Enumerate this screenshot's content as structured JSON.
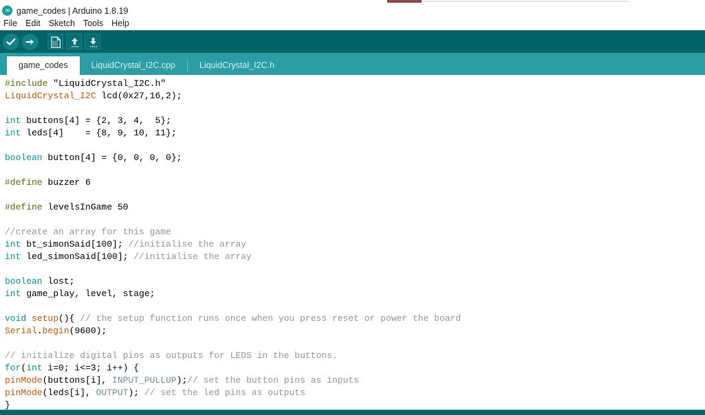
{
  "window": {
    "title": "game_codes | Arduino 1.8.19",
    "logo_icon": "arduino-infinity-icon",
    "logo_glyph": "∞"
  },
  "menu": {
    "items": [
      {
        "label": "File",
        "name": "menu-file"
      },
      {
        "label": "Edit",
        "name": "menu-edit"
      },
      {
        "label": "Sketch",
        "name": "menu-sketch"
      },
      {
        "label": "Tools",
        "name": "menu-tools"
      },
      {
        "label": "Help",
        "name": "menu-help"
      }
    ]
  },
  "toolbar": {
    "buttons": [
      {
        "label": "Verify",
        "icon": "check-icon",
        "shape": "round"
      },
      {
        "label": "Upload",
        "icon": "arrow-right-icon",
        "shape": "round"
      },
      {
        "label": "New",
        "icon": "new-document-icon",
        "shape": "square"
      },
      {
        "label": "Open",
        "icon": "arrow-up-icon",
        "shape": "square"
      },
      {
        "label": "Save",
        "icon": "arrow-down-icon",
        "shape": "square"
      }
    ]
  },
  "tabs": {
    "items": [
      {
        "label": "game_codes",
        "active": true
      },
      {
        "label": "LiquidCrystal_I2C.cpp",
        "active": false
      },
      {
        "label": "LiquidCrystal_I2C.h",
        "active": false
      }
    ]
  },
  "colors": {
    "toolbar_bg": "#006468",
    "tabbar_bg": "#2a9da5",
    "active_tab_bg": "#ffffff",
    "editor_bg": "#ffffff",
    "keyword": "#00979c",
    "preprocessor": "#5e6d03",
    "function": "#d35400",
    "constant": "#718c9e",
    "comment": "#959595"
  },
  "editor": {
    "lines": [
      [
        {
          "t": "#include ",
          "c": "pre"
        },
        {
          "t": "\"LiquidCrystal_I2C.h\"",
          "c": "plain"
        }
      ],
      [
        {
          "t": "LiquidCrystal_I2C",
          "c": "type"
        },
        {
          "t": " lcd(0x27,16,2);",
          "c": "plain"
        }
      ],
      [
        {
          "t": "",
          "c": "plain"
        }
      ],
      [
        {
          "t": "int",
          "c": "kw"
        },
        {
          "t": " buttons[4] = {2, 3, 4,  5};",
          "c": "plain"
        }
      ],
      [
        {
          "t": "int",
          "c": "kw"
        },
        {
          "t": " leds[4]    = {8, 9, 10, 11};",
          "c": "plain"
        }
      ],
      [
        {
          "t": "",
          "c": "plain"
        }
      ],
      [
        {
          "t": "boolean",
          "c": "kw"
        },
        {
          "t": " button[4] = {0, 0, 0, 0};",
          "c": "plain"
        }
      ],
      [
        {
          "t": "",
          "c": "plain"
        }
      ],
      [
        {
          "t": "#define",
          "c": "pre"
        },
        {
          "t": " buzzer 6",
          "c": "plain"
        }
      ],
      [
        {
          "t": "",
          "c": "plain"
        }
      ],
      [
        {
          "t": "#define",
          "c": "pre"
        },
        {
          "t": " levelsInGame 50",
          "c": "plain"
        }
      ],
      [
        {
          "t": "",
          "c": "plain"
        }
      ],
      [
        {
          "t": "//create an array for this game",
          "c": "com"
        }
      ],
      [
        {
          "t": "int",
          "c": "kw"
        },
        {
          "t": " bt_simonSaid[100]; ",
          "c": "plain"
        },
        {
          "t": "//initialise the array",
          "c": "com"
        }
      ],
      [
        {
          "t": "int",
          "c": "kw"
        },
        {
          "t": " led_simonSaid[100]; ",
          "c": "plain"
        },
        {
          "t": "//initialise the array",
          "c": "com"
        }
      ],
      [
        {
          "t": "",
          "c": "plain"
        }
      ],
      [
        {
          "t": "boolean",
          "c": "kw"
        },
        {
          "t": " lost;",
          "c": "plain"
        }
      ],
      [
        {
          "t": "int",
          "c": "kw"
        },
        {
          "t": " game_play, level, stage;",
          "c": "plain"
        }
      ],
      [
        {
          "t": "",
          "c": "plain"
        }
      ],
      [
        {
          "t": "void",
          "c": "kw"
        },
        {
          "t": " ",
          "c": "plain"
        },
        {
          "t": "setup",
          "c": "fn"
        },
        {
          "t": "(){ ",
          "c": "plain"
        },
        {
          "t": "// the setup function runs once when you press reset or power the board",
          "c": "com"
        }
      ],
      [
        {
          "t": "Serial",
          "c": "type"
        },
        {
          "t": ".",
          "c": "plain"
        },
        {
          "t": "begin",
          "c": "fn"
        },
        {
          "t": "(9600);",
          "c": "plain"
        }
      ],
      [
        {
          "t": "",
          "c": "plain"
        }
      ],
      [
        {
          "t": "// initialize digital pins as outputs for LEDS in the buttons.",
          "c": "com"
        }
      ],
      [
        {
          "t": "for",
          "c": "kw"
        },
        {
          "t": "(",
          "c": "plain"
        },
        {
          "t": "int",
          "c": "kw"
        },
        {
          "t": " i=0; i<=3; i++) {",
          "c": "plain"
        }
      ],
      [
        {
          "t": "pinMode",
          "c": "fn"
        },
        {
          "t": "(buttons[i], ",
          "c": "plain"
        },
        {
          "t": "INPUT_PULLUP",
          "c": "const"
        },
        {
          "t": ");",
          "c": "plain"
        },
        {
          "t": "// set the button pins as inputs",
          "c": "com"
        }
      ],
      [
        {
          "t": "pinMode",
          "c": "fn"
        },
        {
          "t": "(leds[i], ",
          "c": "plain"
        },
        {
          "t": "OUTPUT",
          "c": "const"
        },
        {
          "t": "); ",
          "c": "plain"
        },
        {
          "t": "// set the led pins as outputs",
          "c": "com"
        }
      ],
      [
        {
          "t": "}",
          "c": "plain"
        }
      ]
    ]
  }
}
